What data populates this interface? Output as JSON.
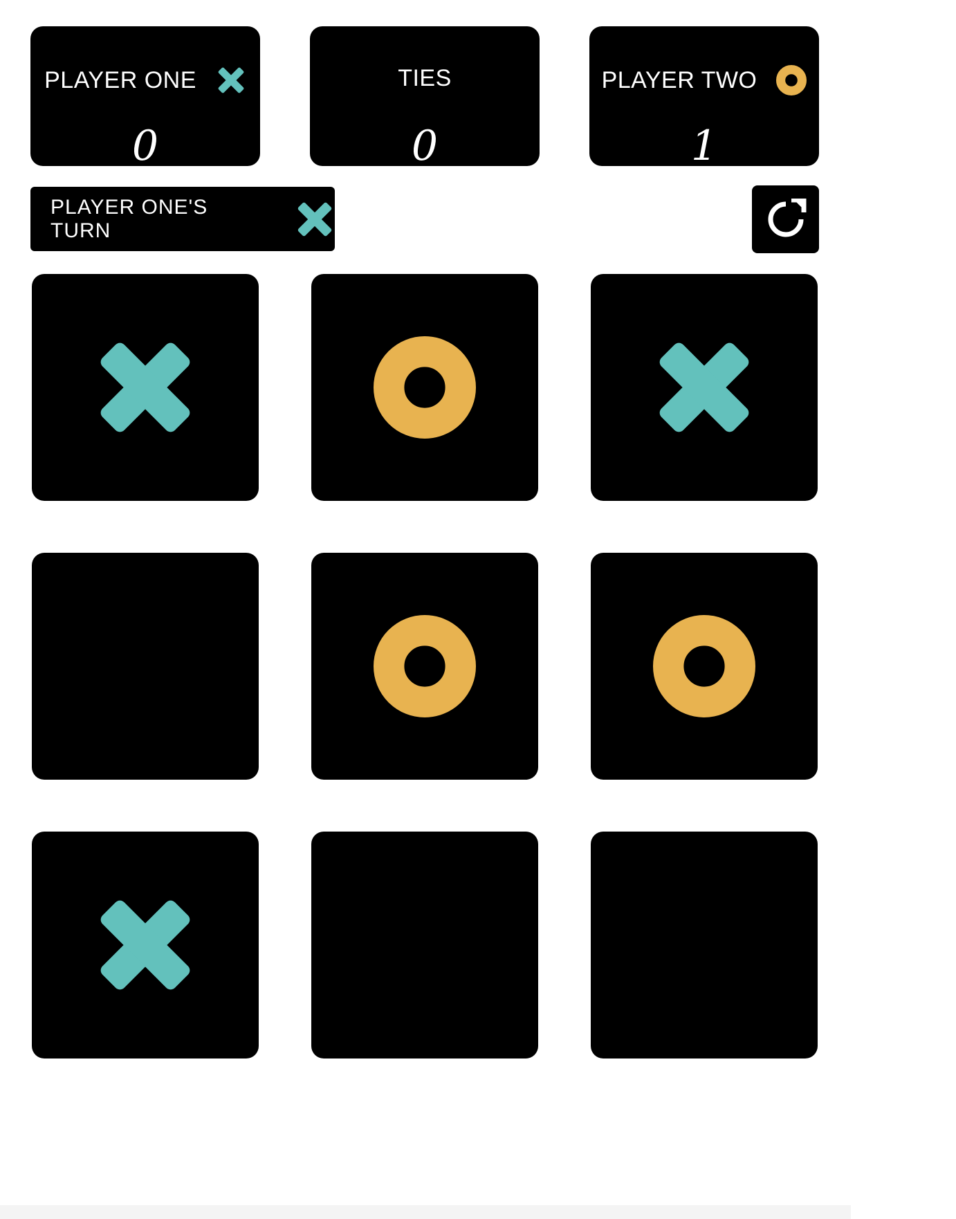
{
  "scoreboard": {
    "player_one": {
      "label": "PLAYER ONE",
      "score": "0",
      "mark": "x-icon"
    },
    "ties": {
      "label": "TIES",
      "score": "0"
    },
    "player_two": {
      "label": "PLAYER TWO",
      "score": "1",
      "mark": "o-icon"
    }
  },
  "turn": {
    "label": "PLAYER ONE'S TURN",
    "mark": "x-icon"
  },
  "reset": {
    "icon": "restart-icon"
  },
  "board": {
    "cells": [
      "X",
      "O",
      "X",
      "",
      "O",
      "O",
      "X",
      "",
      ""
    ]
  },
  "colors": {
    "x": "#63c1bc",
    "o": "#e8b350",
    "panel": "#000000",
    "background": "#ffffff",
    "text": "#ffffff"
  }
}
